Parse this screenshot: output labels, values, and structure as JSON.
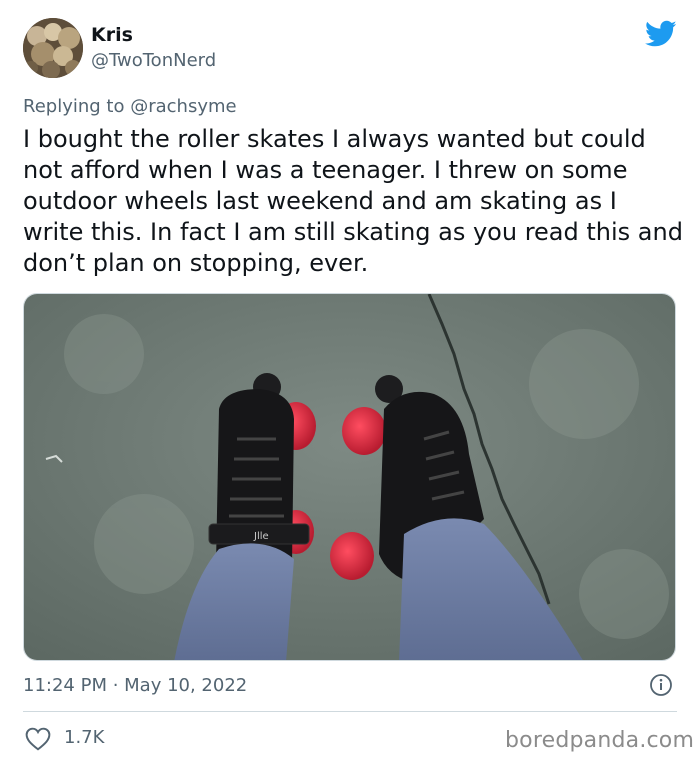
{
  "tweet": {
    "display_name": "Kris",
    "handle": "@TwoTonNerd",
    "replying_prefix": "Replying to ",
    "replying_to": "@rachsyme",
    "text": "I bought the roller skates I always wanted but could not afford when I was a teenager. I threw on some outdoor wheels last weekend and am skating as I write this. In fact I am still skating as you read this and don’t plan on stopping, ever.",
    "time": "11:24 PM · May 10, 2022",
    "likes": "1.7K"
  },
  "photo": {
    "strap_text": "Jlle"
  },
  "watermark": "boredpanda.com",
  "colors": {
    "twitter_blue": "#1d9bf0",
    "secondary_text": "#536471",
    "wheel_red": "#d9263b"
  },
  "icons": [
    "twitter-bird-icon",
    "info-icon",
    "heart-icon"
  ]
}
